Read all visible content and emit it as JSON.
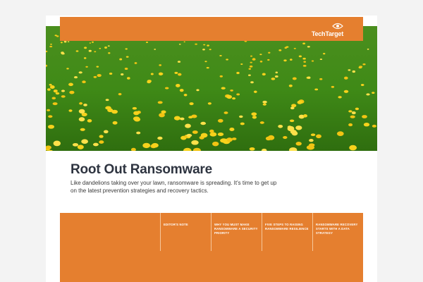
{
  "brand": {
    "logo_text": "TechTarget"
  },
  "title": "Root Out Ransomware",
  "subtitle": "Like dandelions taking over your lawn, ransomware is spreading. It's time to get up on the latest prevention strategies and recovery tactics.",
  "nav": [
    {
      "label": "EDITOR'S NOTE"
    },
    {
      "label": "WHY YOU MUST MAKE RANSOMWARE A SECURITY PRIORITY"
    },
    {
      "label": "FIVE STEPS TO RAISING RANSOMWARE RESILIENCE"
    },
    {
      "label": "RANSOMWARE RECOVERY STARTS WITH A DATA STRATEGY"
    }
  ],
  "colors": {
    "accent": "#e57f2f",
    "title": "#2e3440",
    "text": "#3a3a3a",
    "background": "#f3f3f3"
  },
  "icons": {
    "logo": "eye-target-icon"
  }
}
